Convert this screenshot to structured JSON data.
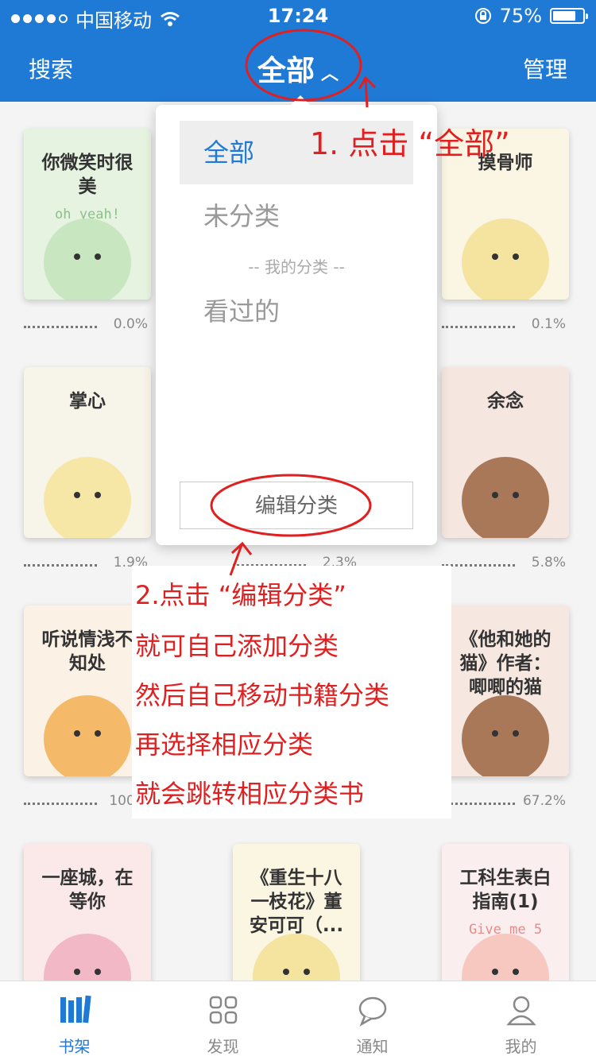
{
  "status_bar": {
    "carrier": "中国移动",
    "time": "17:24",
    "battery": "75%",
    "battery_level": 0.75
  },
  "nav": {
    "left_label": "搜索",
    "title": "全部",
    "right_label": "管理"
  },
  "books": [
    {
      "title": "你微笑时很美",
      "subtitle": "oh yeah!",
      "progress": "0.0%",
      "bg": "#e6f3e0",
      "subtitle_color": "#8cc08a"
    },
    {
      "title": "",
      "subtitle": "",
      "progress": "",
      "bg": "#f6f2e7",
      "subtitle_color": ""
    },
    {
      "title": "摸骨师",
      "subtitle": "",
      "progress": "0.1%",
      "bg": "#fbf6e4",
      "subtitle_color": ""
    },
    {
      "title": "掌心",
      "subtitle": "",
      "progress": "1.9%",
      "bg": "#f7f4ea",
      "subtitle_color": ""
    },
    {
      "title": "",
      "subtitle": "",
      "progress": "2.3%",
      "bg": "#f6f2e7",
      "subtitle_color": ""
    },
    {
      "title": "余念",
      "subtitle": "",
      "progress": "5.8%",
      "bg": "#f6e6e0",
      "subtitle_color": ""
    },
    {
      "title": "听说情浅不知处",
      "subtitle": "",
      "progress": "100.0",
      "bg": "#fbf1e4",
      "subtitle_color": ""
    },
    {
      "title": "",
      "subtitle": "",
      "progress": "",
      "bg": "#f6f2e7",
      "subtitle_color": ""
    },
    {
      "title": "《他和她的猫》作者：唧唧的猫",
      "subtitle": "",
      "progress": "67.2%",
      "bg": "#f6e8e0",
      "subtitle_color": ""
    },
    {
      "title": "一座城，在等你",
      "subtitle": "",
      "progress": "",
      "bg": "#fbe9ea",
      "subtitle_color": ""
    },
    {
      "title": "《重生十八一枝花》董安可可（...",
      "subtitle": "",
      "progress": "",
      "bg": "#fbf6e2",
      "subtitle_color": ""
    },
    {
      "title": "工科生表白指南(1)",
      "subtitle": "Give me 5",
      "progress": "",
      "bg": "#fbeeee",
      "subtitle_color": "#e78a8a"
    }
  ],
  "dropdown": {
    "items": [
      {
        "label": "全部",
        "active": true
      },
      {
        "label": "未分类",
        "active": false
      },
      {
        "label": "看过的",
        "active": false
      }
    ],
    "separator": "-- 我的分类 --",
    "edit_label": "编辑分类"
  },
  "annotations": {
    "step1": "1. 点击 “全部”",
    "lines": [
      "2.点击 “编辑分类”",
      "就可自己添加分类",
      "然后自己移动书籍分类",
      "再选择相应分类",
      "就会跳转相应分类书"
    ]
  },
  "tabbar": {
    "tabs": [
      {
        "label": "书架",
        "icon": "bookshelf-icon",
        "active": true
      },
      {
        "label": "发现",
        "icon": "grid-icon",
        "active": false
      },
      {
        "label": "通知",
        "icon": "chat-bubble-icon",
        "active": false
      },
      {
        "label": "我的",
        "icon": "person-icon",
        "active": false
      }
    ]
  },
  "colors": {
    "primary": "#1f7ad6",
    "annotation": "#e02020"
  }
}
